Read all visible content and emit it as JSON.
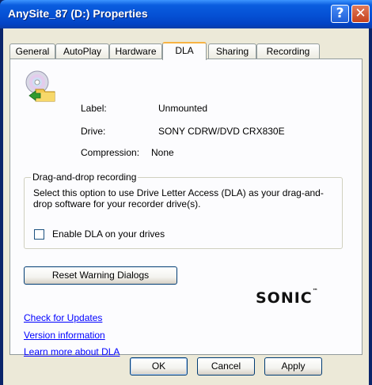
{
  "window": {
    "title": "AnySite_87 (D:) Properties",
    "help_glyph": "?",
    "close_glyph": "✕"
  },
  "tabs": [
    {
      "label": "General"
    },
    {
      "label": "AutoPlay"
    },
    {
      "label": "Hardware"
    },
    {
      "label": "DLA",
      "active": true
    },
    {
      "label": "Sharing"
    },
    {
      "label": "Recording"
    }
  ],
  "drive_info": {
    "label_key": "Label:",
    "label_value": "Unmounted",
    "drive_key": "Drive:",
    "drive_value": "SONY CDRW/DVD CRX830E",
    "compression_key": "Compression:",
    "compression_value": "None"
  },
  "dnd_group": {
    "title": "Drag-and-drop recording",
    "description": "Select this option to use Drive Letter Access (DLA) as your drag-and-drop software for your recorder drive(s).",
    "checkbox_label": "Enable DLA on your drives",
    "checked": false
  },
  "reset_button": "Reset Warning Dialogs",
  "links": {
    "updates": "Check for Updates",
    "version": "Version information",
    "learn": "Learn more about DLA"
  },
  "brand": {
    "name": "SONIC",
    "mark": "™"
  },
  "footer": {
    "ok": "OK",
    "cancel": "Cancel",
    "apply": "Apply"
  },
  "colors": {
    "titlebar": "#0550d4",
    "link": "#0000ff",
    "active_tab_accent": "#f7b343"
  },
  "icons": {
    "drive": "cd-drive-with-folder-icon",
    "help": "help-icon",
    "close": "close-icon"
  }
}
